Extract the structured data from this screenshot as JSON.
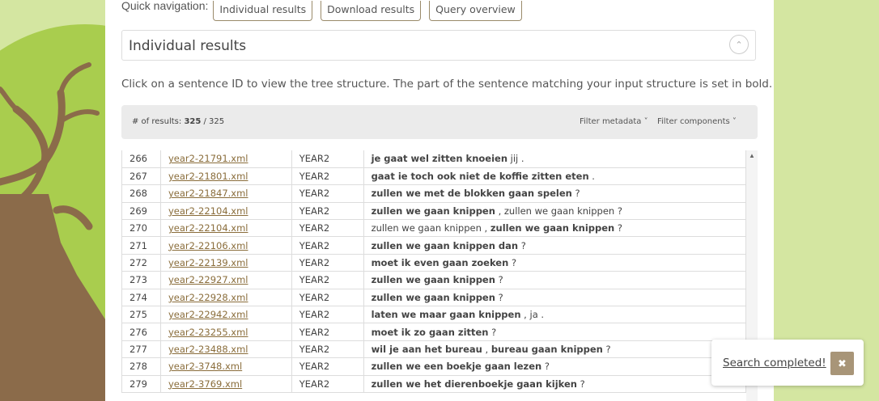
{
  "quick_nav": {
    "label": "Quick navigation:",
    "buttons": [
      "Individual results",
      "Download results",
      "Query overview"
    ]
  },
  "section": {
    "title": "Individual results",
    "toggle_icon": "chevron-up-icon"
  },
  "description": "Click on a sentence ID to view the tree structure. The part of the sentence matching your input structure is set in bold.",
  "results_bar": {
    "count_label": "# of results:",
    "count_shown": "325",
    "count_total": "/ 325",
    "filter_metadata": "Filter metadata",
    "filter_components": "Filter components"
  },
  "rows": [
    {
      "num": "266",
      "id": "year2-21791.xml",
      "year": "YEAR2",
      "parts": [
        {
          "t": "je gaat wel zitten knoeien",
          "b": true
        },
        {
          "t": " jij .",
          "b": false
        }
      ]
    },
    {
      "num": "267",
      "id": "year2-21801.xml",
      "year": "YEAR2",
      "parts": [
        {
          "t": "gaat ie toch ook niet de koffie zitten eten",
          "b": true
        },
        {
          "t": " .",
          "b": false
        }
      ]
    },
    {
      "num": "268",
      "id": "year2-21847.xml",
      "year": "YEAR2",
      "parts": [
        {
          "t": "zullen we met de blokken gaan spelen",
          "b": true
        },
        {
          "t": " ?",
          "b": false
        }
      ]
    },
    {
      "num": "269",
      "id": "year2-22104.xml",
      "year": "YEAR2",
      "parts": [
        {
          "t": "zullen we gaan knippen",
          "b": true
        },
        {
          "t": " , zullen we gaan knippen ?",
          "b": false
        }
      ]
    },
    {
      "num": "270",
      "id": "year2-22104.xml",
      "year": "YEAR2",
      "parts": [
        {
          "t": "zullen we gaan knippen , ",
          "b": false
        },
        {
          "t": "zullen we gaan knippen",
          "b": true
        },
        {
          "t": " ?",
          "b": false
        }
      ]
    },
    {
      "num": "271",
      "id": "year2-22106.xml",
      "year": "YEAR2",
      "parts": [
        {
          "t": "zullen we gaan knippen dan",
          "b": true
        },
        {
          "t": " ?",
          "b": false
        }
      ]
    },
    {
      "num": "272",
      "id": "year2-22139.xml",
      "year": "YEAR2",
      "parts": [
        {
          "t": "moet ik even gaan zoeken",
          "b": true
        },
        {
          "t": " ?",
          "b": false
        }
      ]
    },
    {
      "num": "273",
      "id": "year2-22927.xml",
      "year": "YEAR2",
      "parts": [
        {
          "t": "zullen we gaan knippen",
          "b": true
        },
        {
          "t": " ?",
          "b": false
        }
      ]
    },
    {
      "num": "274",
      "id": "year2-22928.xml",
      "year": "YEAR2",
      "parts": [
        {
          "t": "zullen we gaan knippen",
          "b": true
        },
        {
          "t": " ?",
          "b": false
        }
      ]
    },
    {
      "num": "275",
      "id": "year2-22942.xml",
      "year": "YEAR2",
      "parts": [
        {
          "t": "laten we maar gaan knippen",
          "b": true
        },
        {
          "t": " , ja .",
          "b": false
        }
      ]
    },
    {
      "num": "276",
      "id": "year2-23255.xml",
      "year": "YEAR2",
      "parts": [
        {
          "t": "moet ik zo gaan zitten",
          "b": true
        },
        {
          "t": " ?",
          "b": false
        }
      ]
    },
    {
      "num": "277",
      "id": "year2-23488.xml",
      "year": "YEAR2",
      "parts": [
        {
          "t": "wil je aan het bureau",
          "b": true
        },
        {
          "t": " , ",
          "b": false
        },
        {
          "t": "bureau gaan knippen",
          "b": true
        },
        {
          "t": " ?",
          "b": false
        }
      ]
    },
    {
      "num": "278",
      "id": "year2-3748.xml",
      "year": "YEAR2",
      "parts": [
        {
          "t": "zullen we een boekje gaan lezen",
          "b": true
        },
        {
          "t": " ?",
          "b": false
        }
      ]
    },
    {
      "num": "279",
      "id": "year2-3769.xml",
      "year": "YEAR2",
      "parts": [
        {
          "t": "zullen we het dierenboekje gaan kijken",
          "b": true
        },
        {
          "t": " ?",
          "b": false
        }
      ]
    }
  ],
  "toast": {
    "message": "Search completed!",
    "close_icon": "close-icon"
  },
  "colors": {
    "page_bg": "#d4e6a1",
    "link": "#8a6d3b",
    "accent_button": "#a89578",
    "tree_canopy": "#a9cd4e",
    "tree_trunk": "#8b6b4a"
  }
}
